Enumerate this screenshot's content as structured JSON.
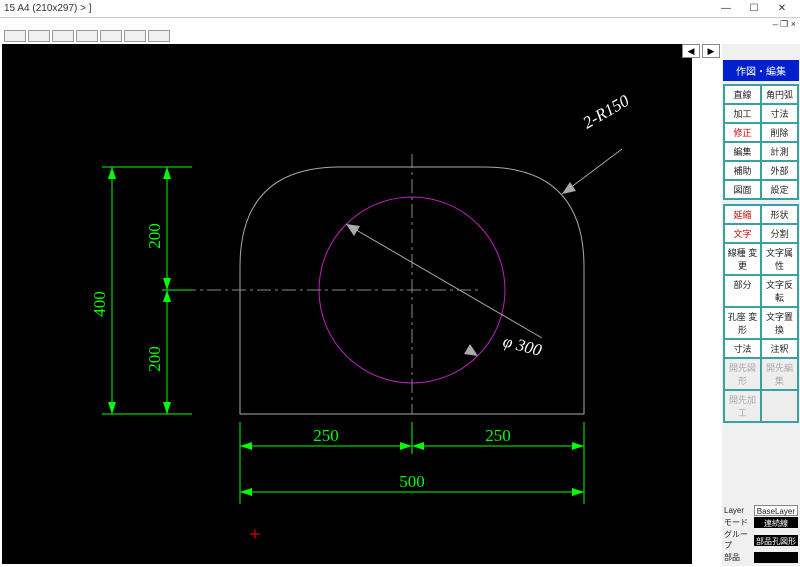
{
  "window": {
    "title": "15 A4 (210x297) >  ]",
    "min": "—",
    "max": "☐",
    "close": "✕",
    "sub_restore": "– ❐ ×"
  },
  "nav": {
    "left": "◀",
    "right": "▶"
  },
  "side": {
    "mode_header": "作図・編集",
    "group1": [
      [
        "直線",
        "角円弧"
      ],
      [
        "加工",
        "寸法"
      ],
      [
        "修正",
        "削除"
      ],
      [
        "編集",
        "計測"
      ],
      [
        "補助",
        "外部"
      ],
      [
        "図面",
        "設定"
      ]
    ],
    "group2": [
      [
        "延縮",
        "形状"
      ],
      [
        "文字",
        "分割"
      ],
      [
        "線種 変更",
        "文字属性"
      ],
      [
        "部分",
        "文字反転"
      ],
      [
        "孔座 変形",
        "文字置換"
      ],
      [
        "寸法",
        "注釈"
      ],
      [
        "開先図形",
        "開先編集"
      ],
      [
        "開先加工",
        ""
      ]
    ]
  },
  "status": {
    "layer_lbl": "Layer",
    "baselayer_lbl": "BaseLayer",
    "mode_lbl": "モード",
    "mode_val": "連続線",
    "group_lbl": "グループ",
    "group_val": "部品孔図形",
    "part_lbl": "部品",
    "part_val": ""
  },
  "drawing": {
    "dim_400": "400",
    "dim_200a": "200",
    "dim_200b": "200",
    "dim_250a": "250",
    "dim_250b": "250",
    "dim_500": "500",
    "ann_r": "2-R150",
    "ann_phi": "φ 300"
  }
}
